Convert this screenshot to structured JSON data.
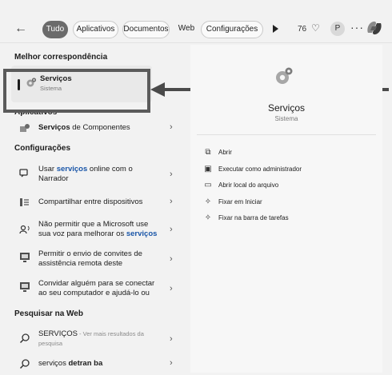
{
  "header": {
    "back_icon": "arrow-left-icon",
    "tabs": [
      "Tudo",
      "Aplicativos",
      "Documentos",
      "Web",
      "Configurações"
    ],
    "points": "76",
    "avatar_letter": "P",
    "more": "···"
  },
  "best_match": {
    "heading": "Melhor correspondência",
    "title": "Serviços",
    "subtitle": "Sistema"
  },
  "apps": {
    "heading": "Aplicativos",
    "item_bold": "Serviços",
    "item_rest": " de Componentes"
  },
  "settings": {
    "heading": "Configurações",
    "items": [
      {
        "line1_pre": "Usar ",
        "line1_bold": "serviços",
        "line1_post": " online com o",
        "line2_pre": "Narrador",
        "line2_bold": "",
        "line2_post": ""
      },
      {
        "line1_pre": "Compartilhar entre dispositivos",
        "line1_bold": "",
        "line1_post": "",
        "line2_pre": "",
        "line2_bold": "",
        "line2_post": ""
      },
      {
        "line1_pre": "Não permitir que a Microsoft use",
        "line1_bold": "",
        "line1_post": "",
        "line2_pre": "sua voz para melhorar os ",
        "line2_bold": "serviços",
        "line2_post": ""
      },
      {
        "line1_pre": "Permitir o envio de convites de",
        "line1_bold": "",
        "line1_post": "",
        "line2_pre": "assistência remota deste",
        "line2_bold": "",
        "line2_post": ""
      },
      {
        "line1_pre": "Convidar alguém para se conectar",
        "line1_bold": "",
        "line1_post": "",
        "line2_pre": "ao seu computador e ajudá-lo ou",
        "line2_bold": "",
        "line2_post": ""
      }
    ]
  },
  "web": {
    "heading": "Pesquisar na Web",
    "item1_title": "SERVIÇOS",
    "item1_hint": " - Ver mais resultados da",
    "item1_hint2": "pesquisa",
    "item2_pre": "serviços ",
    "item2_bold": "detran ba"
  },
  "panel": {
    "title": "Serviços",
    "subtitle": "Sistema",
    "actions": [
      "Abrir",
      "Executar como administrador",
      "Abrir local do arquivo",
      "Fixar em Iniciar",
      "Fixar na barra de tarefas"
    ]
  },
  "chevron": "›"
}
